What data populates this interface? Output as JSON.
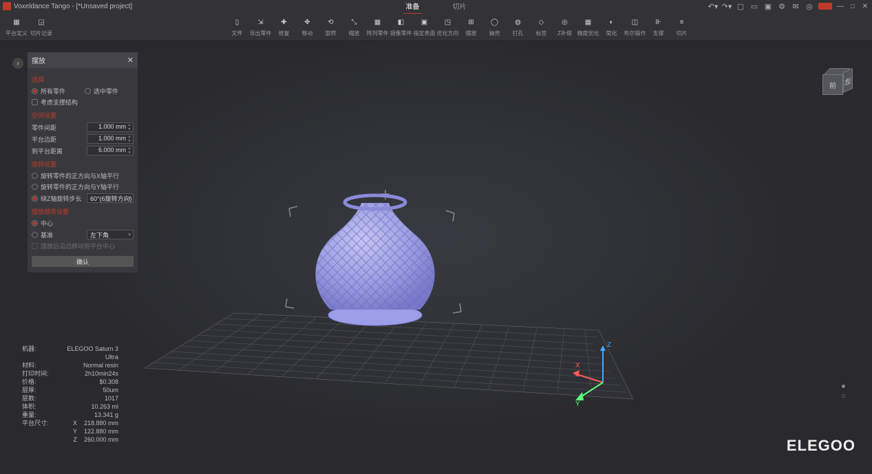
{
  "titlebar": {
    "app": "Voxeldance Tango",
    "project": "- [*Unsaved project]",
    "tabs": {
      "prepare": "准备",
      "slice": "切片"
    }
  },
  "toolbar": {
    "left": [
      {
        "id": "platform-def",
        "label": "平台定义"
      },
      {
        "id": "slice-record",
        "label": "切片记录"
      }
    ],
    "main": [
      {
        "id": "file",
        "label": "文件"
      },
      {
        "id": "export",
        "label": "导出零件"
      },
      {
        "id": "repair",
        "label": "修复"
      },
      {
        "id": "move",
        "label": "移动"
      },
      {
        "id": "rotate",
        "label": "旋转"
      },
      {
        "id": "scale",
        "label": "缩放"
      },
      {
        "id": "array",
        "label": "阵列零件"
      },
      {
        "id": "mirror",
        "label": "镜像零件"
      },
      {
        "id": "surface",
        "label": "指定表面"
      },
      {
        "id": "optimize",
        "label": "优化方向"
      },
      {
        "id": "pack",
        "label": "摆放"
      },
      {
        "id": "hollow",
        "label": "抽壳"
      },
      {
        "id": "hole",
        "label": "打孔"
      },
      {
        "id": "label",
        "label": "标签"
      },
      {
        "id": "zcomp",
        "label": "Z补偿"
      },
      {
        "id": "accuracy",
        "label": "精度优化"
      },
      {
        "id": "simplify",
        "label": "简化"
      },
      {
        "id": "boolean",
        "label": "布尔操作"
      },
      {
        "id": "support",
        "label": "支撑"
      },
      {
        "id": "slice",
        "label": "切片"
      }
    ]
  },
  "panel": {
    "title": "摆放",
    "select": {
      "heading": "选择",
      "all": "所有零件",
      "selected": "选中零件",
      "consider": "考虑支撑结构"
    },
    "space": {
      "heading": "空间设置",
      "gap": {
        "label": "零件间距",
        "value": "1.000 mm"
      },
      "edge": {
        "label": "平台边距",
        "value": "1.000 mm"
      },
      "plat": {
        "label": "到平台距离",
        "value": "6.000 mm"
      }
    },
    "rot": {
      "heading": "旋转设置",
      "x": "旋转零件的正方向与X轴平行",
      "y": "旋转零件的正方向与Y轴平行",
      "step": {
        "label": "绕Z轴旋转步长",
        "value": "60°(6旋转方向)"
      }
    },
    "order": {
      "heading": "摆放顺序设置",
      "center": "中心",
      "ref": "基准",
      "ref_value": "左下角",
      "move": "摆放后沿边移动到平台中心"
    },
    "ok": "确认"
  },
  "info": {
    "machine": {
      "k": "机器:",
      "v": "ELEGOO Saturn 3 Ultra"
    },
    "material": {
      "k": "材料:",
      "v": "Normal resin"
    },
    "time": {
      "k": "打印时间:",
      "v": "2h10min24s"
    },
    "price": {
      "k": "价格:",
      "v": "$0.308"
    },
    "layer_h": {
      "k": "层厚:",
      "v": "50um"
    },
    "layers": {
      "k": "层数:",
      "v": "1017"
    },
    "volume": {
      "k": "体积:",
      "v": "10.263 ml"
    },
    "weight": {
      "k": "重量:",
      "v": "13.341 g"
    },
    "size": {
      "k": "平台尺寸:",
      "x": "X",
      "xv": "218.880 mm",
      "y": "Y",
      "yv": "122.880 mm",
      "z": "Z",
      "zv": "260.000 mm"
    }
  },
  "viewcube": {
    "front": "前",
    "side": "左"
  },
  "axes": {
    "x": "X",
    "y": "Y",
    "z": "Z"
  },
  "brand": "ELEGOO"
}
